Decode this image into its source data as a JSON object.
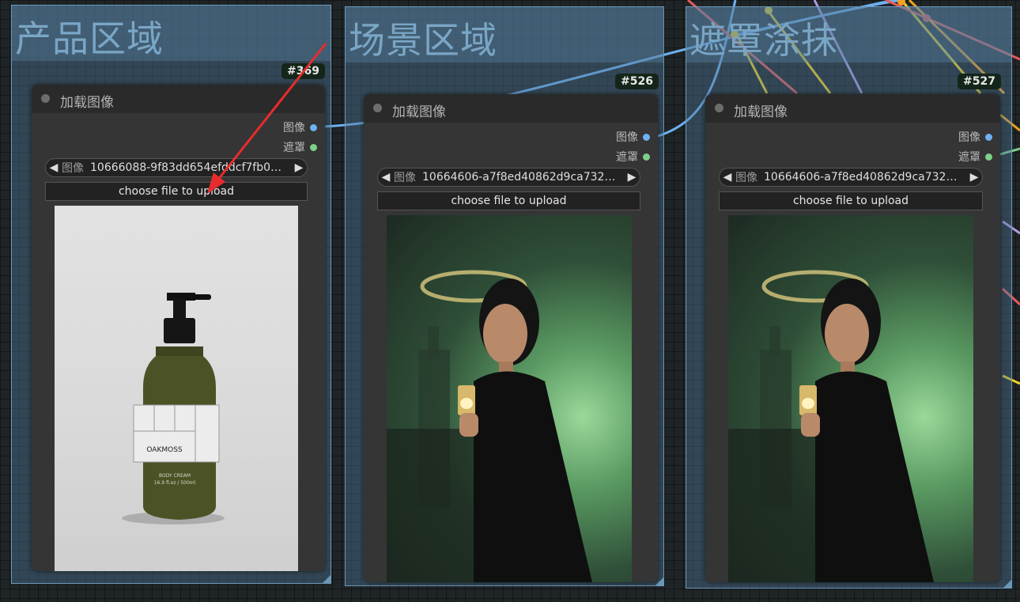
{
  "groups": [
    {
      "title": "产品区域"
    },
    {
      "title": "场景区域"
    },
    {
      "title": "遮罩涂抹"
    }
  ],
  "nodes": [
    {
      "id": "#369",
      "title": "加载图像",
      "outputs": [
        "图像",
        "遮罩"
      ],
      "combo_label": "图像",
      "combo_value": "10666088-9f83dd654efddcf7fb0…",
      "upload_label": "choose file to upload",
      "preview": {
        "product_label": "OAKMOSS",
        "product_sub": "BODY CREAM",
        "product_size": "16.9 fl.oz / 500ml"
      }
    },
    {
      "id": "#526",
      "title": "加载图像",
      "outputs": [
        "图像",
        "遮罩"
      ],
      "combo_label": "图像",
      "combo_value": "10664606-a7f8ed40862d9ca732…",
      "upload_label": "choose file to upload"
    },
    {
      "id": "#527",
      "title": "加载图像",
      "outputs": [
        "图像",
        "遮罩"
      ],
      "combo_label": "图像",
      "combo_value": "10664606-a7f8ed40862d9ca732…",
      "upload_label": "choose file to upload"
    }
  ],
  "colors": {
    "image_port": "#6fb0f0",
    "mask_port": "#7fcf8a",
    "annotation_arrow": "#e82c2c"
  }
}
